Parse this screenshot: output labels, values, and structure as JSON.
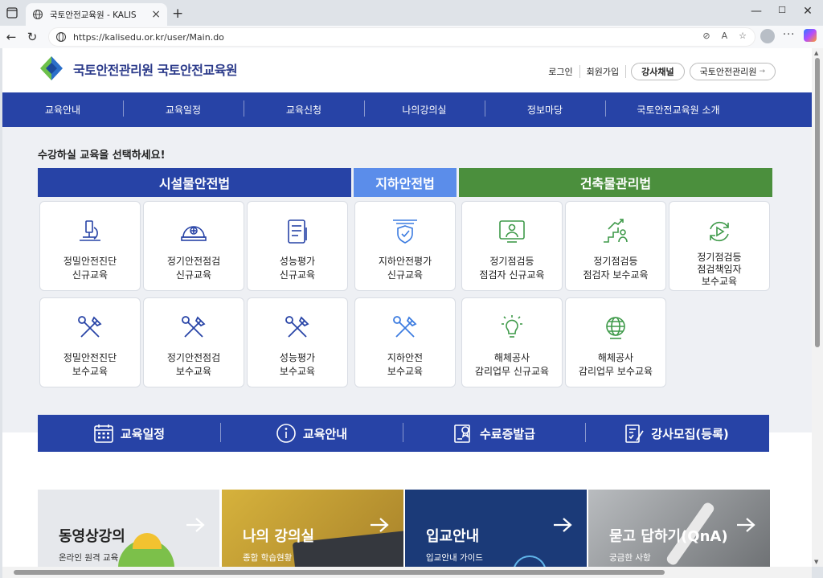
{
  "browser": {
    "tab_title": "국토안전교육원 - KALIS",
    "url": "https://kalisedu.or.kr/user/Main.do",
    "win_min": "—",
    "win_max": "☐",
    "win_close": "✕",
    "more": "···"
  },
  "header": {
    "site_title": "국토안전관리원 국토안전교육원",
    "login": "로그인",
    "signup": "회원가입",
    "instructor_channel": "강사채널",
    "kalis_link": "국토안전관리원"
  },
  "gnb": [
    "교육안내",
    "교육일정",
    "교육신청",
    "나의강의실",
    "정보마당",
    "국토안전교육원 소개"
  ],
  "main": {
    "prompt": "수강하실 교육을 선택하세요!",
    "categories": [
      {
        "label": "시설물안전법",
        "color": "#2743a6"
      },
      {
        "label": "지하안전법",
        "color": "#5b8dea"
      },
      {
        "label": "건축물관리법",
        "color": "#4b8f3d"
      }
    ],
    "courses": [
      {
        "line1": "정밀안전진단",
        "line2": "신규교육",
        "icon": "microscope-icon"
      },
      {
        "line1": "정기안전점검",
        "line2": "신규교육",
        "icon": "helmet-icon"
      },
      {
        "line1": "성능평가",
        "line2": "신규교육",
        "icon": "document-icon"
      },
      {
        "line1": "지하안전평가",
        "line2": "신규교육",
        "icon": "shield-icon"
      },
      {
        "line1": "정기점검등",
        "line2": "점검자 신규교육",
        "icon": "monitor-user-icon"
      },
      {
        "line1": "정기점검등",
        "line2": "점검자 보수교육",
        "icon": "stairs-icon"
      },
      {
        "line1": "정기점검등",
        "line2": "점검책임자",
        "line3": "보수교육",
        "icon": "refresh-play-icon"
      },
      {
        "line1": "정밀안전진단",
        "line2": "보수교육",
        "icon": "tools-icon"
      },
      {
        "line1": "정기안전점검",
        "line2": "보수교육",
        "icon": "tools-icon"
      },
      {
        "line1": "성능평가",
        "line2": "보수교육",
        "icon": "tools-icon"
      },
      {
        "line1": "지하안전",
        "line2": "보수교육",
        "icon": "tools-icon"
      },
      {
        "line1": "해체공사",
        "line2": "감리업무 신규교육",
        "icon": "lightbulb-icon"
      },
      {
        "line1": "해체공사",
        "line2": "감리업무 보수교육",
        "icon": "globe-icon"
      }
    ]
  },
  "quick": [
    "교육일정",
    "교육안내",
    "수료증발급",
    "강사모집(등록)"
  ],
  "banners": [
    {
      "title": "동영상강의",
      "sub": "온라인 원격 교육",
      "bg": "#e6e8ec",
      "fg": "#222"
    },
    {
      "title": "나의 강의실",
      "sub": "종합 학습현황",
      "bg": "#c8a23a",
      "fg": "#fff"
    },
    {
      "title": "입교안내",
      "sub": "입교안내 가이드",
      "bg": "#1b3a78",
      "fg": "#fff"
    },
    {
      "title": "묻고 답하기(QnA)",
      "sub": "궁금한 사항",
      "bg": "#8d8f92",
      "fg": "#fff"
    }
  ]
}
